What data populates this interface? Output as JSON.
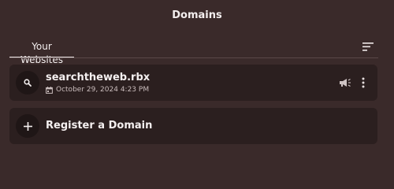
{
  "header": {
    "title": "Domains"
  },
  "tabs": [
    {
      "label": "Your Websites",
      "active": true
    }
  ],
  "toolbar": {
    "sort_icon": "sort-lines-icon"
  },
  "sites": [
    {
      "name": "searchtheweb.rbx",
      "date": "October 29, 2024 4:23 PM",
      "icon": "search-icon"
    }
  ],
  "register": {
    "label": "Register a Domain",
    "icon": "plus-icon"
  },
  "colors": {
    "background": "#3a2a2a",
    "card": "#2b1f1f",
    "icon_circle": "#1f1616",
    "text": "#f4efef",
    "muted_text": "#c9bcbc"
  }
}
